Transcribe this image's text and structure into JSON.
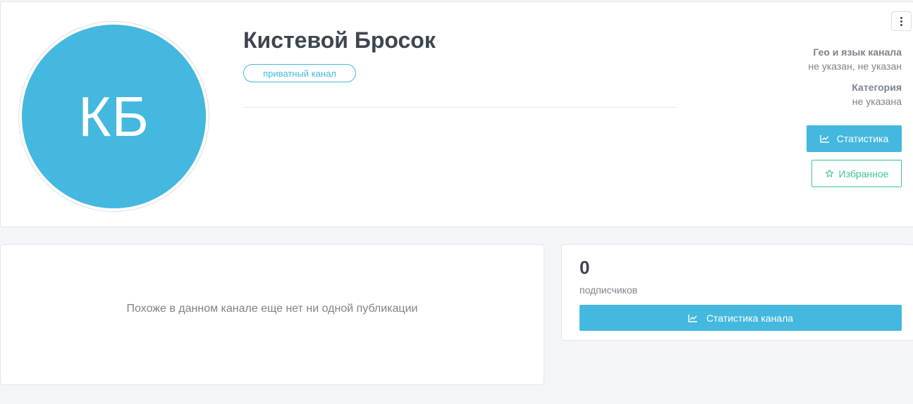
{
  "channel": {
    "avatar_initials": "КБ",
    "title": "Кистевой Бросок",
    "badge": "приватный канал"
  },
  "meta": {
    "geo_label": "Гео и язык канала",
    "geo_value": "не указан, не указан",
    "category_label": "Категория",
    "category_value": "не указана"
  },
  "actions": {
    "statistics_label": "Статистика",
    "favorite_label": "Избранное",
    "more_icon": "vertical-ellipsis-icon"
  },
  "posts": {
    "empty_message": "Похоже в данном канале еще нет ни одной публикации"
  },
  "stats": {
    "subscribers_count": "0",
    "subscribers_label": "подписчиков",
    "channel_stats_label": "Статистика канала"
  },
  "colors": {
    "accent": "#44b8de",
    "favorite": "#3cc48f",
    "background": "#f4f5f8",
    "text": "#3e4550",
    "muted": "#7c838c"
  }
}
